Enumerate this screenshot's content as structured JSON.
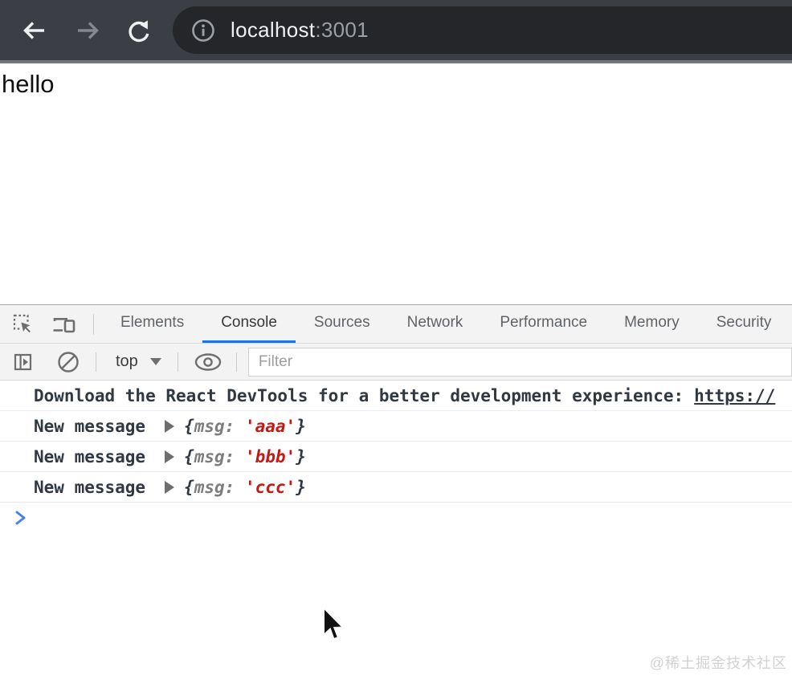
{
  "browser": {
    "back_icon": "arrow-left",
    "forward_icon": "arrow-right",
    "reload_icon": "reload",
    "address": {
      "info_icon": "info-circle",
      "host": "localhost",
      "port": ":3001"
    }
  },
  "page": {
    "text": "hello"
  },
  "devtools": {
    "tab_strip": {
      "inspect_icon": "inspect-element",
      "device_icon": "device-toolbar",
      "tabs": [
        {
          "label": "Elements"
        },
        {
          "label": "Console",
          "active": true
        },
        {
          "label": "Sources"
        },
        {
          "label": "Network"
        },
        {
          "label": "Performance"
        },
        {
          "label": "Memory"
        },
        {
          "label": "Security"
        }
      ]
    },
    "toolbar": {
      "sidebar_icon": "show-console-sidebar",
      "clear_icon": "clear-console",
      "context_selector": {
        "value": "top",
        "caret_icon": "caret-down"
      },
      "eye_icon": "create-live-expression",
      "filter": {
        "placeholder": "Filter",
        "value": ""
      }
    },
    "console": {
      "info_message": {
        "text": "Download the React DevTools for a better development experience:",
        "link_text": "https://"
      },
      "log_messages": [
        {
          "label": "New message",
          "expander_icon": "triangle-right",
          "preview": {
            "open": "{",
            "key": "msg",
            "separator": ": ",
            "value": "'aaa'",
            "close": "}"
          }
        },
        {
          "label": "New message",
          "expander_icon": "triangle-right",
          "preview": {
            "open": "{",
            "key": "msg",
            "separator": ": ",
            "value": "'bbb'",
            "close": "}"
          }
        },
        {
          "label": "New message",
          "expander_icon": "triangle-right",
          "preview": {
            "open": "{",
            "key": "msg",
            "separator": ": ",
            "value": "'ccc'",
            "close": "}"
          }
        }
      ],
      "prompt_icon": "chevron-right"
    }
  },
  "watermark": {
    "text": "@稀土掘金技术社区"
  },
  "colors": {
    "chrome_bg": "#3b3e44",
    "address_pill_bg": "#24262a",
    "accent_blue": "#1a73e8",
    "message_text": "#303942",
    "string_red": "#c41a16",
    "prompt_blue": "#4d7fe8"
  }
}
